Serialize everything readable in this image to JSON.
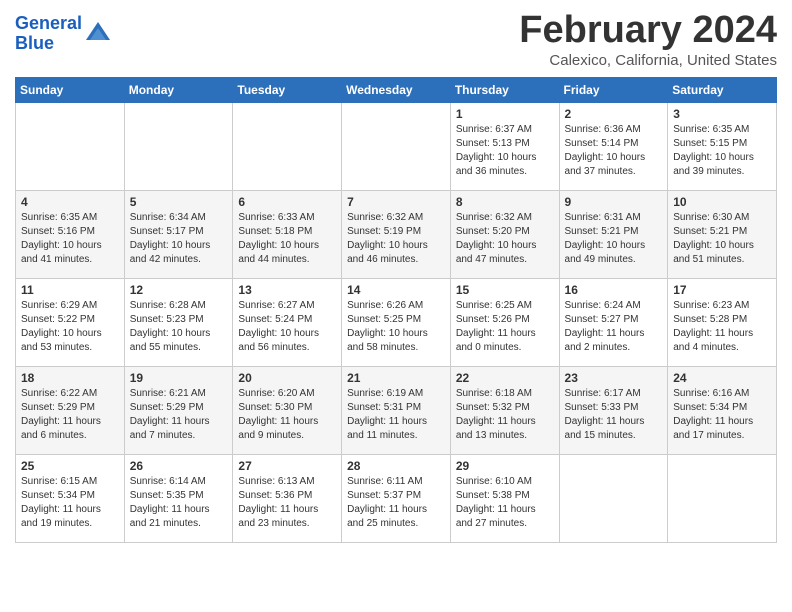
{
  "header": {
    "logo_line1": "General",
    "logo_line2": "Blue",
    "month_title": "February 2024",
    "subtitle": "Calexico, California, United States"
  },
  "days_of_week": [
    "Sunday",
    "Monday",
    "Tuesday",
    "Wednesday",
    "Thursday",
    "Friday",
    "Saturday"
  ],
  "weeks": [
    [
      {
        "day": "",
        "info": ""
      },
      {
        "day": "",
        "info": ""
      },
      {
        "day": "",
        "info": ""
      },
      {
        "day": "",
        "info": ""
      },
      {
        "day": "1",
        "info": "Sunrise: 6:37 AM\nSunset: 5:13 PM\nDaylight: 10 hours\nand 36 minutes."
      },
      {
        "day": "2",
        "info": "Sunrise: 6:36 AM\nSunset: 5:14 PM\nDaylight: 10 hours\nand 37 minutes."
      },
      {
        "day": "3",
        "info": "Sunrise: 6:35 AM\nSunset: 5:15 PM\nDaylight: 10 hours\nand 39 minutes."
      }
    ],
    [
      {
        "day": "4",
        "info": "Sunrise: 6:35 AM\nSunset: 5:16 PM\nDaylight: 10 hours\nand 41 minutes."
      },
      {
        "day": "5",
        "info": "Sunrise: 6:34 AM\nSunset: 5:17 PM\nDaylight: 10 hours\nand 42 minutes."
      },
      {
        "day": "6",
        "info": "Sunrise: 6:33 AM\nSunset: 5:18 PM\nDaylight: 10 hours\nand 44 minutes."
      },
      {
        "day": "7",
        "info": "Sunrise: 6:32 AM\nSunset: 5:19 PM\nDaylight: 10 hours\nand 46 minutes."
      },
      {
        "day": "8",
        "info": "Sunrise: 6:32 AM\nSunset: 5:20 PM\nDaylight: 10 hours\nand 47 minutes."
      },
      {
        "day": "9",
        "info": "Sunrise: 6:31 AM\nSunset: 5:21 PM\nDaylight: 10 hours\nand 49 minutes."
      },
      {
        "day": "10",
        "info": "Sunrise: 6:30 AM\nSunset: 5:21 PM\nDaylight: 10 hours\nand 51 minutes."
      }
    ],
    [
      {
        "day": "11",
        "info": "Sunrise: 6:29 AM\nSunset: 5:22 PM\nDaylight: 10 hours\nand 53 minutes."
      },
      {
        "day": "12",
        "info": "Sunrise: 6:28 AM\nSunset: 5:23 PM\nDaylight: 10 hours\nand 55 minutes."
      },
      {
        "day": "13",
        "info": "Sunrise: 6:27 AM\nSunset: 5:24 PM\nDaylight: 10 hours\nand 56 minutes."
      },
      {
        "day": "14",
        "info": "Sunrise: 6:26 AM\nSunset: 5:25 PM\nDaylight: 10 hours\nand 58 minutes."
      },
      {
        "day": "15",
        "info": "Sunrise: 6:25 AM\nSunset: 5:26 PM\nDaylight: 11 hours\nand 0 minutes."
      },
      {
        "day": "16",
        "info": "Sunrise: 6:24 AM\nSunset: 5:27 PM\nDaylight: 11 hours\nand 2 minutes."
      },
      {
        "day": "17",
        "info": "Sunrise: 6:23 AM\nSunset: 5:28 PM\nDaylight: 11 hours\nand 4 minutes."
      }
    ],
    [
      {
        "day": "18",
        "info": "Sunrise: 6:22 AM\nSunset: 5:29 PM\nDaylight: 11 hours\nand 6 minutes."
      },
      {
        "day": "19",
        "info": "Sunrise: 6:21 AM\nSunset: 5:29 PM\nDaylight: 11 hours\nand 7 minutes."
      },
      {
        "day": "20",
        "info": "Sunrise: 6:20 AM\nSunset: 5:30 PM\nDaylight: 11 hours\nand 9 minutes."
      },
      {
        "day": "21",
        "info": "Sunrise: 6:19 AM\nSunset: 5:31 PM\nDaylight: 11 hours\nand 11 minutes."
      },
      {
        "day": "22",
        "info": "Sunrise: 6:18 AM\nSunset: 5:32 PM\nDaylight: 11 hours\nand 13 minutes."
      },
      {
        "day": "23",
        "info": "Sunrise: 6:17 AM\nSunset: 5:33 PM\nDaylight: 11 hours\nand 15 minutes."
      },
      {
        "day": "24",
        "info": "Sunrise: 6:16 AM\nSunset: 5:34 PM\nDaylight: 11 hours\nand 17 minutes."
      }
    ],
    [
      {
        "day": "25",
        "info": "Sunrise: 6:15 AM\nSunset: 5:34 PM\nDaylight: 11 hours\nand 19 minutes."
      },
      {
        "day": "26",
        "info": "Sunrise: 6:14 AM\nSunset: 5:35 PM\nDaylight: 11 hours\nand 21 minutes."
      },
      {
        "day": "27",
        "info": "Sunrise: 6:13 AM\nSunset: 5:36 PM\nDaylight: 11 hours\nand 23 minutes."
      },
      {
        "day": "28",
        "info": "Sunrise: 6:11 AM\nSunset: 5:37 PM\nDaylight: 11 hours\nand 25 minutes."
      },
      {
        "day": "29",
        "info": "Sunrise: 6:10 AM\nSunset: 5:38 PM\nDaylight: 11 hours\nand 27 minutes."
      },
      {
        "day": "",
        "info": ""
      },
      {
        "day": "",
        "info": ""
      }
    ]
  ]
}
